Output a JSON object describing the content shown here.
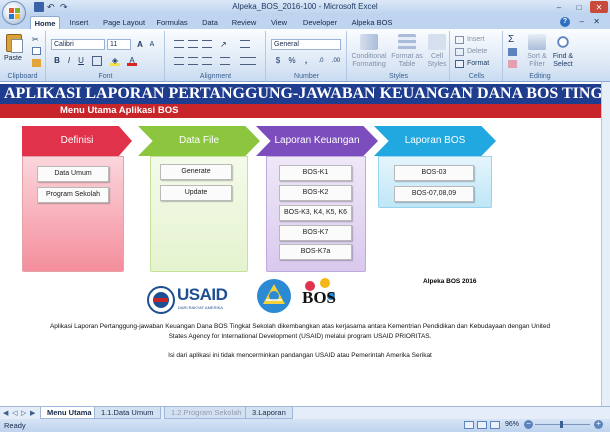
{
  "window": {
    "title": "Alpeka_BOS_2016-100 - Microsoft Excel",
    "min_glyph": "–",
    "max_glyph": "□",
    "close_glyph": "✕"
  },
  "ribbon_tabs": [
    "Home",
    "Insert",
    "Page Layout",
    "Formulas",
    "Data",
    "Review",
    "View",
    "Developer",
    "Alpeka BOS"
  ],
  "ribbon_controls": {
    "help": "?",
    "minimize": "–",
    "close": "✕"
  },
  "clipboard": {
    "paste": "Paste",
    "label": "Clipboard"
  },
  "font_group": {
    "font_name": "Calibri",
    "font_size": "11",
    "grow": "A",
    "shrink": "A",
    "bold": "B",
    "italic": "I",
    "underline": "U",
    "font_color": "A",
    "label": "Font"
  },
  "alignment_group": {
    "label": "Alignment"
  },
  "number_group": {
    "format": "General",
    "currency": "$",
    "percent": "%",
    "comma": ",",
    "inc_decimal": ".0",
    "dec_decimal": ".00",
    "label": "Number"
  },
  "styles_group": {
    "conditional": "Conditional Formatting",
    "format_table": "Format as Table",
    "cell_styles": "Cell Styles",
    "label": "Styles"
  },
  "cells_group": {
    "insert": "Insert",
    "delete": "Delete",
    "format": "Format",
    "label": "Cells"
  },
  "editing_group": {
    "sigma": "Σ",
    "sort_filter": "Sort & Filter",
    "find_select": "Find & Select",
    "label": "Editing"
  },
  "sheet": {
    "banner": "APLIKASI LAPORAN PERTANGGUNG-JAWABAN  KEUANGAN DANA BOS TINGKAT SEKOLAH",
    "menu_title": "Menu Utama  Aplikasi BOS",
    "columns": [
      {
        "title": "Definisi",
        "buttons": [
          "Data Umum",
          "Program Sekolah"
        ]
      },
      {
        "title": "Data File",
        "buttons": [
          "Generate",
          "Update"
        ]
      },
      {
        "title": "Laporan Keuangan",
        "buttons": [
          "BOS-K1",
          "BOS-K2",
          "BOS-K3, K4, K5, K6",
          "BOS-K7",
          "BOS-K7a"
        ]
      },
      {
        "title": "Laporan BOS",
        "buttons": [
          "BOS-03",
          "BOS-07,08,09"
        ]
      }
    ],
    "logo_usaid_text": "USAID",
    "logo_usaid_tagline": "DARI RAKYAT AMERIKA",
    "logo_bos_text": "BOS",
    "version": "Alpeka BOS 2016",
    "description": "Aplikasi Laporan Pertanggung-jawaban Keuangan Dana BOS Tingkat Sekolah dikembangkan atas kerjasama antara Kementrian Pendidikan dan Kebudayaan dengan United States Agency for International Development (USAID) melalui program USAID PRIORITAS.",
    "disclaimer": "Isi dari aplikasi ini tidak mencerminkan pandangan USAID atau Pemerintah Amerika Serikat"
  },
  "sheet_tabs": [
    "Menu Utama",
    "1.1.Data Umum",
    "1.2.Program Sekolah",
    "3.Laporan"
  ],
  "status": {
    "text": "Ready",
    "zoom": "96%",
    "minus": "−",
    "plus": "+"
  },
  "colors": {
    "banner": "#1f3d8f",
    "menu_bar": "#c8252b",
    "definisi": "#e0324a",
    "data_file": "#8cc63f",
    "laporan_keuangan": "#7c4dbc",
    "laporan_bos": "#21a8e0"
  }
}
